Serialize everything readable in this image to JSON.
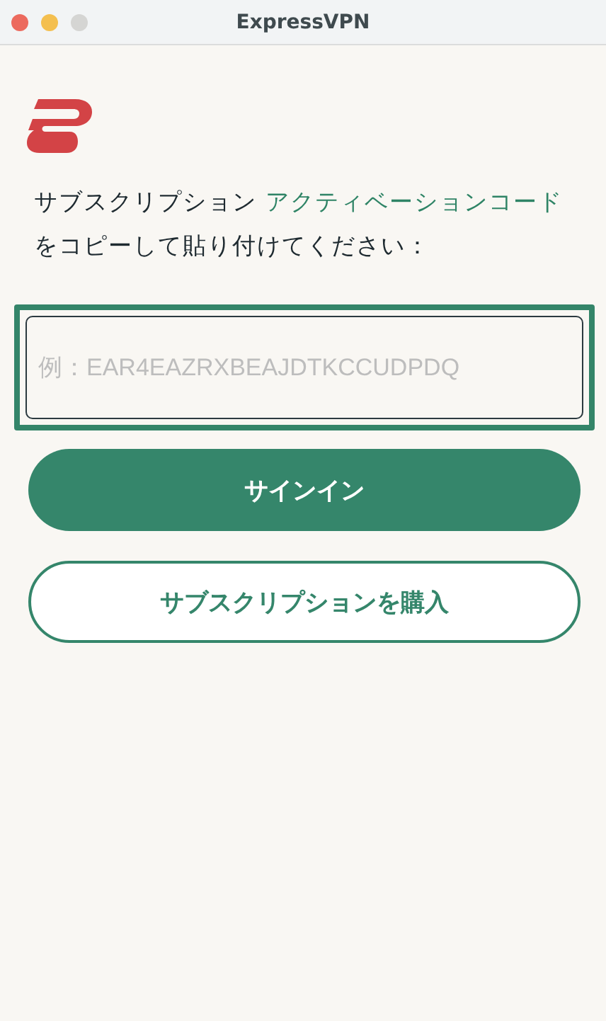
{
  "window": {
    "title": "ExpressVPN",
    "buttons": [
      {
        "kind": "close",
        "disabled": false
      },
      {
        "kind": "minimize",
        "disabled": false
      },
      {
        "kind": "zoom",
        "disabled": true
      }
    ]
  },
  "instruction": [
    {
      "text": "サブスクリプション ",
      "emphasis": false
    },
    {
      "text": "アクティベーションコード",
      "emphasis": true
    },
    {
      "text": " をコピーして貼り付けてください：",
      "emphasis": false
    }
  ],
  "code_field": {
    "placeholder": "例：EAR4EAZRXBEAJDTKCCUDPDQ",
    "highlighted": true
  },
  "buttons": [
    {
      "label": "サインイン",
      "kind": "primary"
    },
    {
      "label": "サブスクリプションを購入",
      "kind": "secondary"
    }
  ]
}
